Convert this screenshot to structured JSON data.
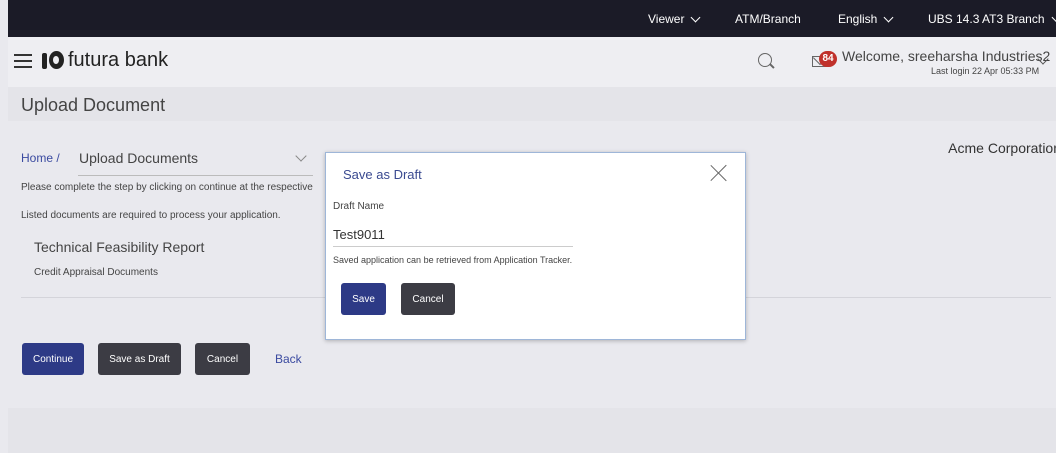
{
  "topbar": {
    "viewer": "Viewer",
    "atm": "ATM/Branch",
    "language": "English",
    "branch": "UBS 14.3 AT3 Branch"
  },
  "header": {
    "logo": "futura bank",
    "mail_count": "84",
    "welcome": "Welcome, sreeharsha Industries2",
    "last_login": "Last login 22 Apr 05:33 PM"
  },
  "page": {
    "title": "Upload Document",
    "breadcrumb_home": "Home /",
    "breadcrumb_select": "Upload Documents",
    "company": "Acme Corporation",
    "instruction1": "Please complete the step by clicking on continue at the respective",
    "instruction2": "Listed documents are required to process your application.",
    "doc_title": "Technical Feasibility Report",
    "doc_category": "Credit Appraisal Documents"
  },
  "actions": {
    "continue": "Continue",
    "save_draft": "Save as Draft",
    "cancel": "Cancel",
    "back": "Back"
  },
  "modal": {
    "title": "Save as Draft",
    "label": "Draft Name",
    "value": "Test9011",
    "hint": "Saved application can be retrieved from Application Tracker.",
    "save": "Save",
    "cancel": "Cancel"
  }
}
